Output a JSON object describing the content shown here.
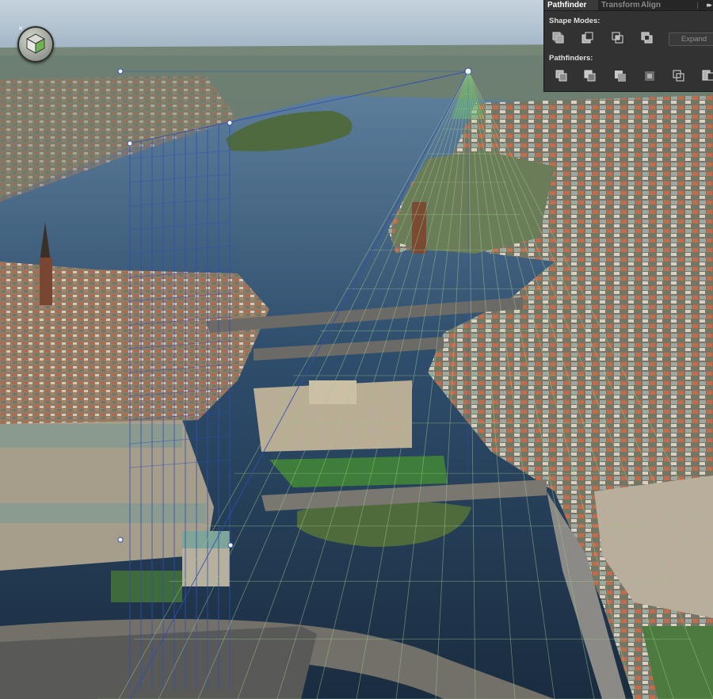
{
  "panel": {
    "tabs": [
      {
        "label": "Pathfinder",
        "active": true
      },
      {
        "label": "Transform",
        "active": false
      },
      {
        "label": "Align",
        "active": false
      }
    ],
    "menu_icon": "panel-menu-icon",
    "shape_modes": {
      "label": "Shape Modes:",
      "buttons": [
        "unite-icon",
        "minus-front-icon",
        "intersect-icon",
        "exclude-icon"
      ],
      "expand_label": "Expand"
    },
    "pathfinders": {
      "label": "Pathfinders:",
      "buttons": [
        "divide-icon",
        "trim-icon",
        "merge-icon",
        "crop-icon",
        "outline-icon",
        "minus-back-icon"
      ]
    }
  },
  "widget": {
    "icon": "perspective-plane-switching-widget-icon",
    "close_icon": "close-icon"
  },
  "colors": {
    "panel_bg": "#323232",
    "grid_blue": "#2e4fb5",
    "grid_green": "#9fc98c",
    "active_tab_text": "#ffffff"
  }
}
